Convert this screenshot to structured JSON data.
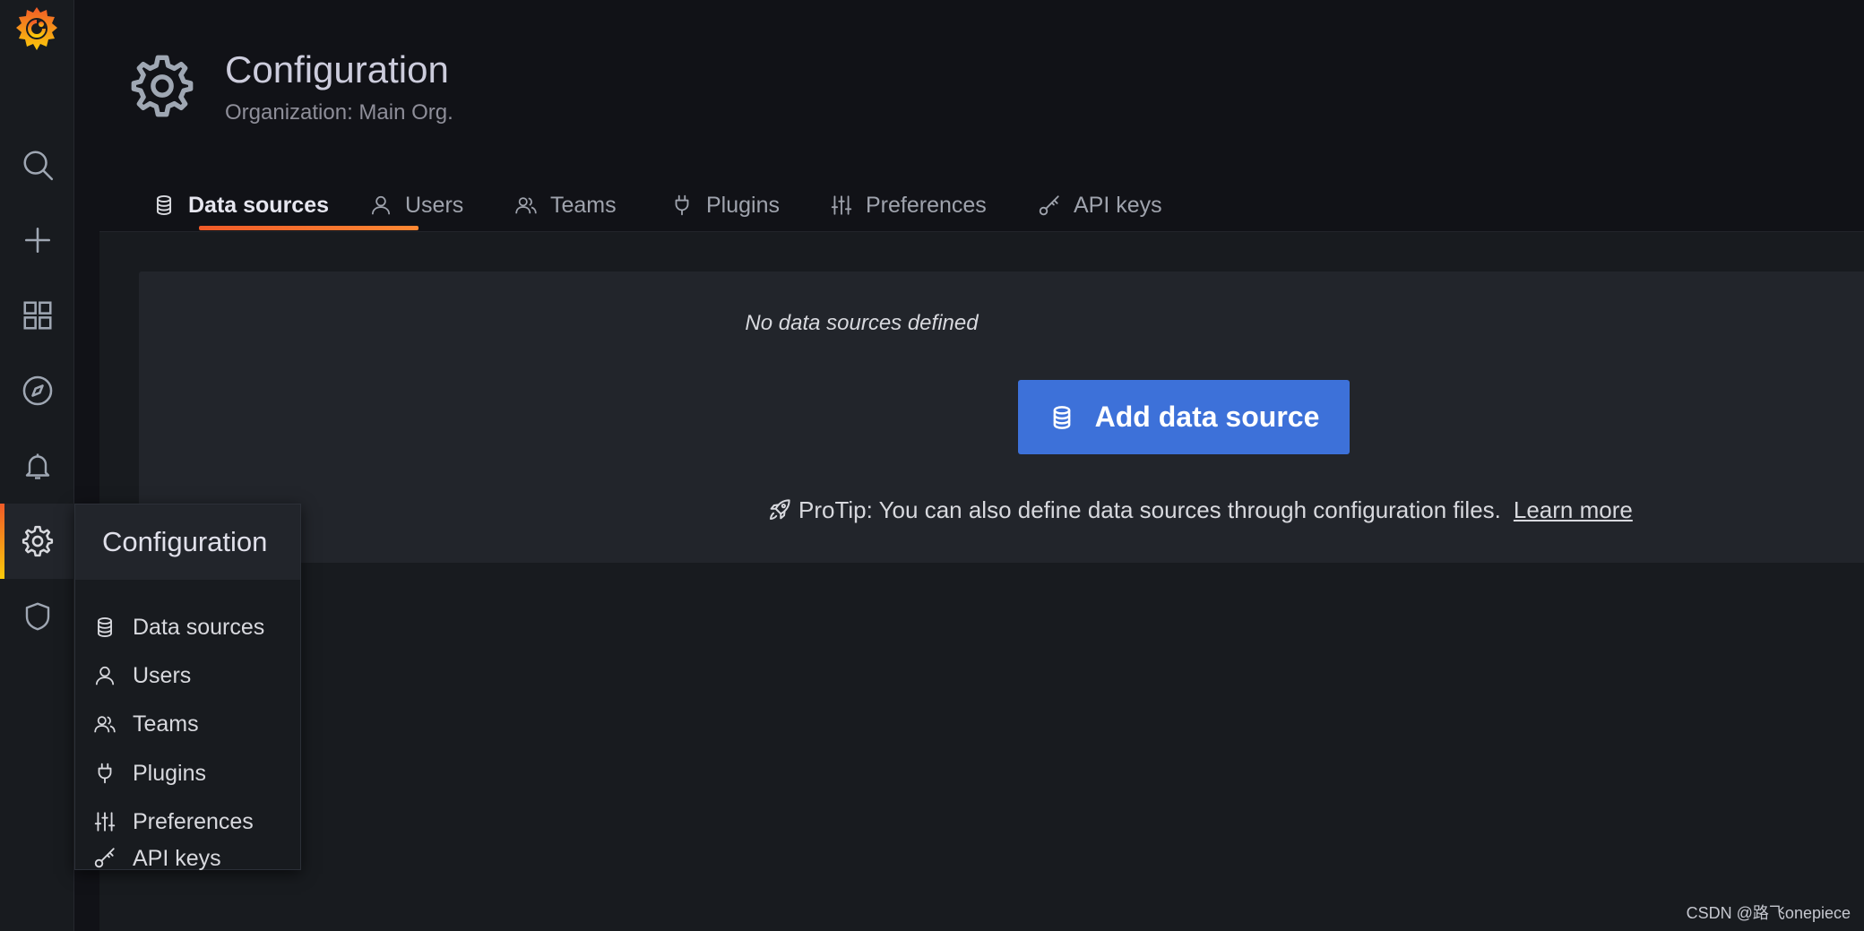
{
  "header": {
    "title": "Configuration",
    "subtitle": "Organization: Main Org."
  },
  "tabs": [
    {
      "label": "Data sources",
      "icon": "database-icon",
      "active": true
    },
    {
      "label": "Users",
      "icon": "user-icon"
    },
    {
      "label": "Teams",
      "icon": "users-icon"
    },
    {
      "label": "Plugins",
      "icon": "plug-icon"
    },
    {
      "label": "Preferences",
      "icon": "sliders-icon"
    },
    {
      "label": "API keys",
      "icon": "key-icon"
    }
  ],
  "sidebar": {
    "items": [
      {
        "name": "search",
        "icon": "search-icon"
      },
      {
        "name": "create",
        "icon": "plus-icon"
      },
      {
        "name": "dashboards",
        "icon": "apps-icon"
      },
      {
        "name": "explore",
        "icon": "compass-icon"
      },
      {
        "name": "alerting",
        "icon": "bell-icon"
      },
      {
        "name": "configuration",
        "icon": "gear-icon",
        "active": true
      },
      {
        "name": "server-admin",
        "icon": "shield-icon"
      }
    ]
  },
  "empty_state": {
    "message": "No data sources defined",
    "button_label": "Add data source",
    "protip": "ProTip: You can also define data sources through configuration files.",
    "learn_more": "Learn more"
  },
  "flyout": {
    "title": "Configuration",
    "items": [
      {
        "label": "Data sources",
        "icon": "database-icon"
      },
      {
        "label": "Users",
        "icon": "user-icon"
      },
      {
        "label": "Teams",
        "icon": "users-icon"
      },
      {
        "label": "Plugins",
        "icon": "plug-icon"
      },
      {
        "label": "Preferences",
        "icon": "sliders-icon"
      },
      {
        "label": "API keys",
        "icon": "key-icon"
      }
    ]
  },
  "watermark": "CSDN @路飞onepiece",
  "colors": {
    "accent_orange": "#f05a28",
    "primary_button": "#3d71d9",
    "page_bg": "#111217",
    "panel_bg": "#22252b"
  }
}
